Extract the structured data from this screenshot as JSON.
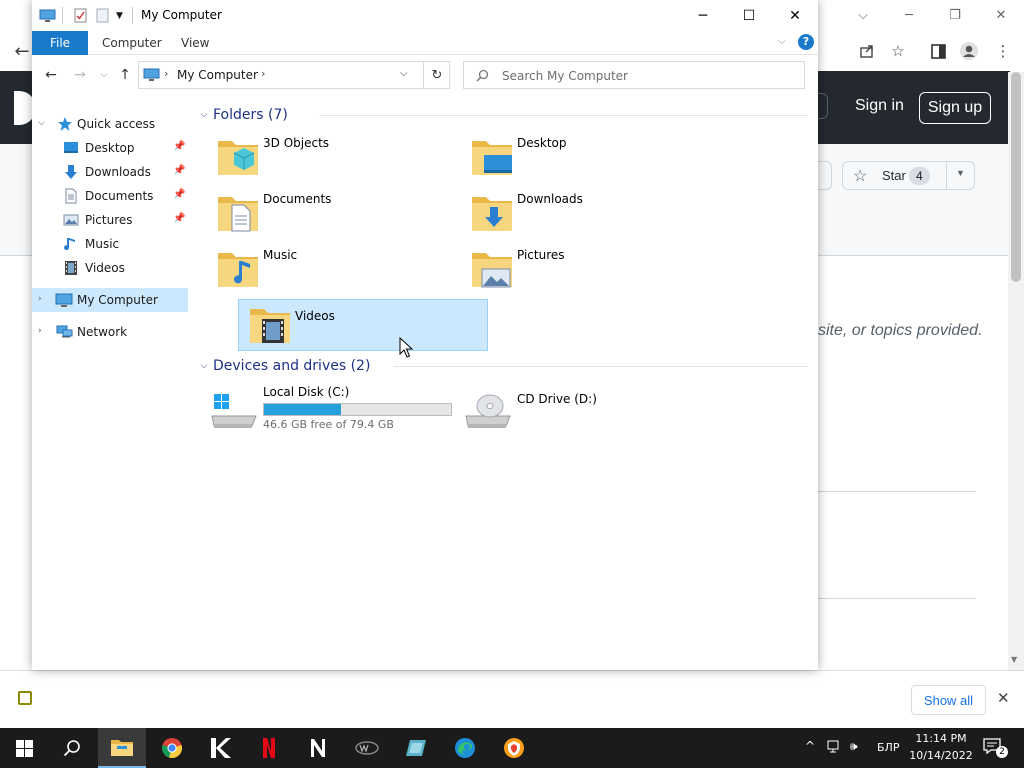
{
  "browser": {
    "github": {
      "sign_in": "Sign in",
      "sign_up": "Sign up",
      "star_label": "Star",
      "star_count": "4",
      "description_fragment": "site, or topics provided."
    },
    "download_bar": {
      "show_all": "Show all"
    }
  },
  "explorer": {
    "title": "My Computer",
    "ribbon_tabs": [
      "File",
      "Computer",
      "View"
    ],
    "address": {
      "location": "My Computer"
    },
    "search": {
      "placeholder": "Search My Computer"
    },
    "nav_pane": {
      "quick_access": "Quick access",
      "quick_items": [
        {
          "label": "Desktop",
          "pinned": true
        },
        {
          "label": "Downloads",
          "pinned": true
        },
        {
          "label": "Documents",
          "pinned": true
        },
        {
          "label": "Pictures",
          "pinned": true
        },
        {
          "label": "Music",
          "pinned": false
        },
        {
          "label": "Videos",
          "pinned": false
        }
      ],
      "my_computer": "My Computer",
      "network": "Network"
    },
    "folders_group": "Folders (7)",
    "folders": [
      {
        "label": "3D Objects",
        "icon": "3d-objects-folder-icon"
      },
      {
        "label": "Desktop",
        "icon": "desktop-folder-icon"
      },
      {
        "label": "Documents",
        "icon": "documents-folder-icon"
      },
      {
        "label": "Downloads",
        "icon": "downloads-folder-icon"
      },
      {
        "label": "Music",
        "icon": "music-folder-icon"
      },
      {
        "label": "Pictures",
        "icon": "pictures-folder-icon"
      },
      {
        "label": "Videos",
        "icon": "videos-folder-icon",
        "selected": true
      }
    ],
    "drives_group": "Devices and drives (2)",
    "drives": [
      {
        "label": "Local Disk (C:)",
        "free_text": "46.6 GB free of 79.4 GB",
        "used_fraction": 0.413
      },
      {
        "label": "CD Drive (D:)"
      }
    ]
  },
  "taskbar": {
    "apps": [
      "windows-start-icon",
      "search-icon",
      "file-explorer-icon",
      "chrome-icon",
      "app-k-icon",
      "netflix-icon",
      "notion-icon",
      "wd-icon",
      "app-blue-icon",
      "edge-icon",
      "app-shield-icon"
    ],
    "language": "БЛР",
    "time": "11:14 PM",
    "date": "10/14/2022",
    "notification_count": "2"
  },
  "colors": {
    "accent": "#1979ca",
    "selection": "#cce8ff",
    "drive_fill": "#26a0da",
    "github_header": "#24292f"
  }
}
